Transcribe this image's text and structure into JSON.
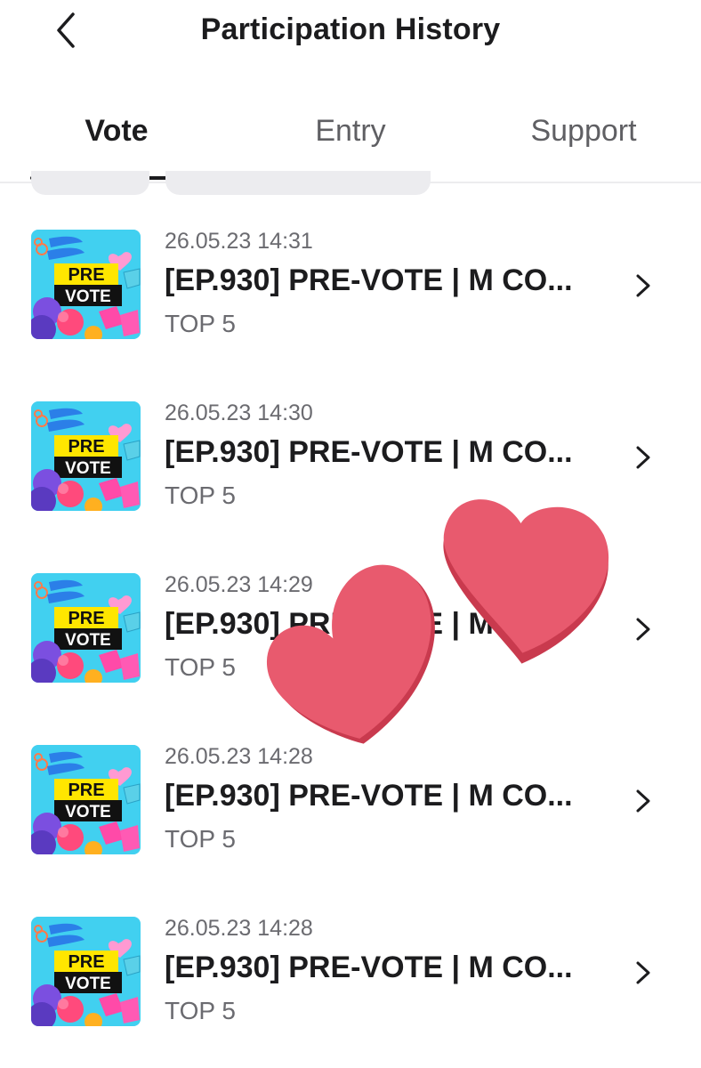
{
  "header": {
    "title": "Participation History",
    "back_icon": "chevron-left-icon"
  },
  "tabs": [
    {
      "label": "Vote",
      "active": true
    },
    {
      "label": "Entry",
      "active": false
    },
    {
      "label": "Support",
      "active": false
    }
  ],
  "items": [
    {
      "date": "26.05.23 14:31",
      "title": "[EP.930] PRE-VOTE | M CO...",
      "subtitle": "TOP 5",
      "thumb_text_1": "PRE",
      "thumb_text_2": "VOTE"
    },
    {
      "date": "26.05.23 14:30",
      "title": "[EP.930] PRE-VOTE | M CO...",
      "subtitle": "TOP 5",
      "thumb_text_1": "PRE",
      "thumb_text_2": "VOTE"
    },
    {
      "date": "26.05.23 14:29",
      "title": "[EP.930] PRE-VOTE | M CO...",
      "subtitle": "TOP 5",
      "thumb_text_1": "PRE",
      "thumb_text_2": "VOTE"
    },
    {
      "date": "26.05.23 14:28",
      "title": "[EP.930] PRE-VOTE | M CO...",
      "subtitle": "TOP 5",
      "thumb_text_1": "PRE",
      "thumb_text_2": "VOTE"
    },
    {
      "date": "26.05.23 14:28",
      "title": "[EP.930] PRE-VOTE | M CO...",
      "subtitle": "TOP 5",
      "thumb_text_1": "PRE",
      "thumb_text_2": "VOTE"
    }
  ],
  "colors": {
    "heart": "#e85a6e",
    "heart_shadow": "#c93a4e",
    "thumb_bg": "#2fc6e8",
    "thumb_banner": "#ffe600"
  }
}
